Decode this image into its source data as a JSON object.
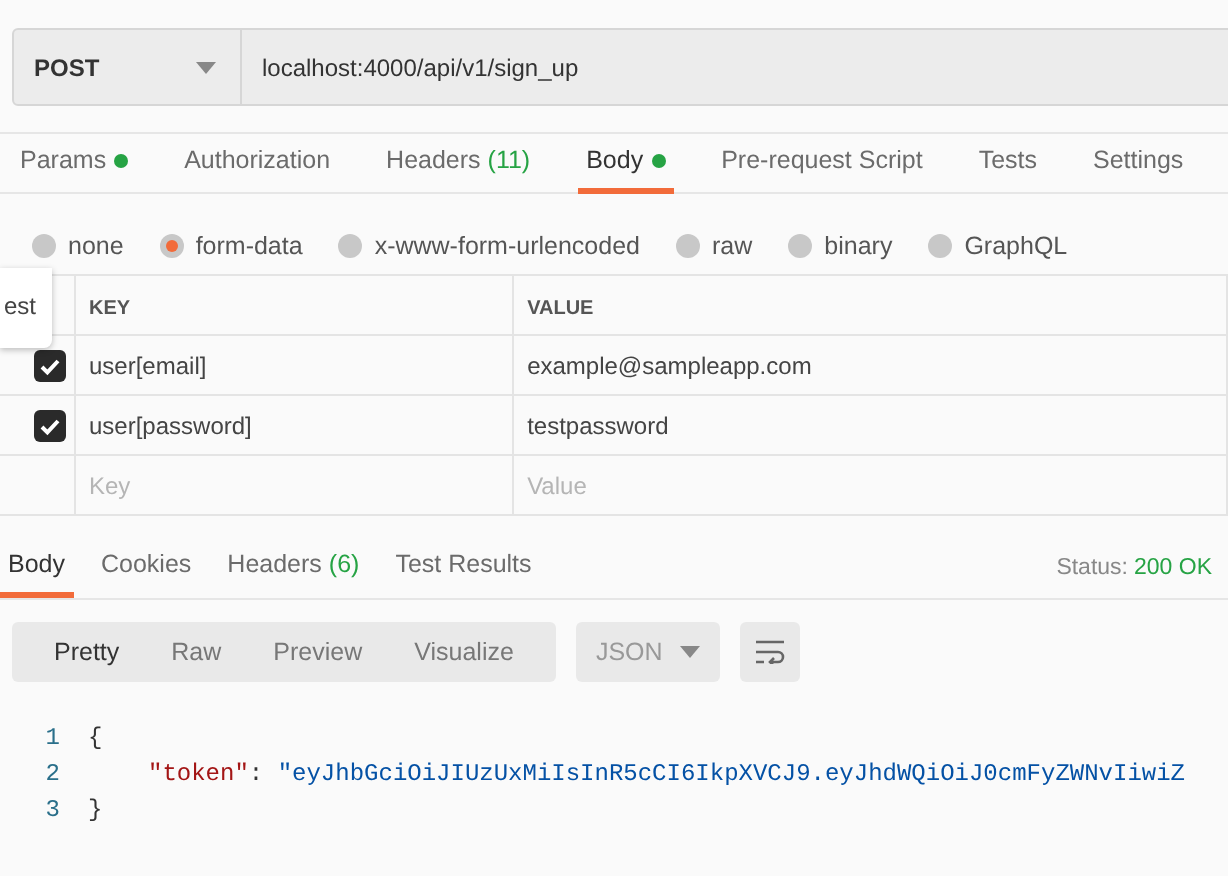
{
  "request": {
    "method": "POST",
    "url": "localhost:4000/api/v1/sign_up"
  },
  "tabs": [
    {
      "label": "Params",
      "dot": true,
      "selected": false
    },
    {
      "label": "Authorization",
      "dot": false,
      "selected": false
    },
    {
      "label": "Headers",
      "dot": false,
      "count": "(11)",
      "selected": false
    },
    {
      "label": "Body",
      "dot": true,
      "selected": true
    },
    {
      "label": "Pre-request Script",
      "dot": false,
      "selected": false
    },
    {
      "label": "Tests",
      "dot": false,
      "selected": false
    },
    {
      "label": "Settings",
      "dot": false,
      "selected": false
    }
  ],
  "body_types": [
    {
      "label": "none",
      "selected": false
    },
    {
      "label": "form-data",
      "selected": true
    },
    {
      "label": "x-www-form-urlencoded",
      "selected": false
    },
    {
      "label": "raw",
      "selected": false
    },
    {
      "label": "binary",
      "selected": false
    },
    {
      "label": "GraphQL",
      "selected": false
    }
  ],
  "tooltip": "est",
  "table": {
    "columns": [
      "KEY",
      "VALUE"
    ],
    "rows": [
      {
        "key": "user[email]",
        "value": "example@sampleapp.com",
        "checked": true
      },
      {
        "key": "user[password]",
        "value": "testpassword",
        "checked": true
      }
    ],
    "new_row": {
      "key_placeholder": "Key",
      "value_placeholder": "Value"
    }
  },
  "response_tabs": [
    {
      "label": "Body",
      "selected": true
    },
    {
      "label": "Cookies",
      "selected": false
    },
    {
      "label": "Headers",
      "count": "(6)",
      "selected": false
    },
    {
      "label": "Test Results",
      "selected": false
    }
  ],
  "status": {
    "label": "Status:",
    "value": "200 OK"
  },
  "view_modes": [
    {
      "label": "Pretty",
      "selected": true
    },
    {
      "label": "Raw",
      "selected": false
    },
    {
      "label": "Preview",
      "selected": false
    },
    {
      "label": "Visualize",
      "selected": false
    }
  ],
  "format": "JSON",
  "code_lines": [
    {
      "number": "1",
      "text": "{"
    },
    {
      "number": "2",
      "key": "\"token\"",
      "sep": ": ",
      "value": "\"eyJhbGciOiJIUzUxMiIsInR5cCI6IkpXVCJ9.eyJhdWQiOiJ0cmFyZWNvIiwiZ"
    },
    {
      "number": "3",
      "text": "}"
    }
  ]
}
